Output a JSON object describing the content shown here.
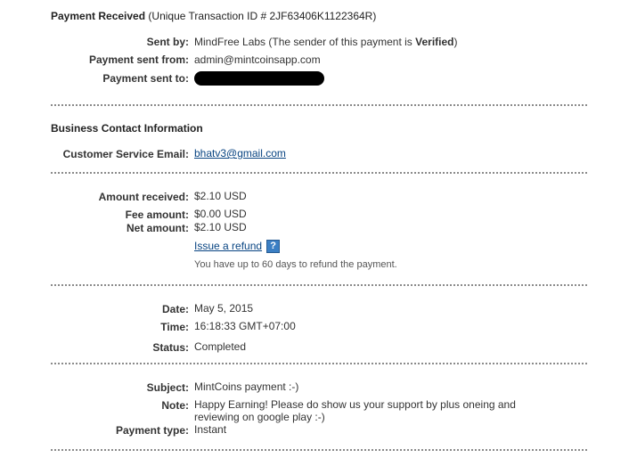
{
  "header": {
    "title": "Payment Received",
    "transaction": "(Unique Transaction ID # 2JF63406K1122364R)"
  },
  "sender": {
    "sent_by_label": "Sent by:",
    "sent_by_value": "MindFree Labs",
    "sent_by_note_prefix": "(The sender of this payment is ",
    "sent_by_note_status": "Verified",
    "sent_by_note_suffix": ")",
    "sent_from_label": "Payment sent from:",
    "sent_from_value": "admin@mintcoinsapp.com",
    "sent_to_label": "Payment sent to:"
  },
  "business": {
    "title": "Business Contact Information",
    "email_label": "Customer Service Email:",
    "email_value": "bhatv3@gmail.com"
  },
  "amounts": {
    "received_label": "Amount received:",
    "received_value": "$2.10 USD",
    "fee_label": "Fee amount:",
    "fee_value": "$0.00 USD",
    "net_label": "Net amount:",
    "net_value": "$2.10 USD",
    "refund_link": "Issue a refund",
    "help_icon": "?",
    "refund_note": "You have up to 60 days to refund the payment."
  },
  "datetime": {
    "date_label": "Date:",
    "date_value": "May 5, 2015",
    "time_label": "Time:",
    "time_value": "16:18:33 GMT+07:00",
    "status_label": "Status:",
    "status_value": "Completed"
  },
  "details": {
    "subject_label": "Subject:",
    "subject_value": "MintCoins payment :-)",
    "note_label": "Note:",
    "note_line1": "Happy Earning! Please do show us your support by plus oneing and",
    "note_line2": "reviewing on google play :-)",
    "type_label": "Payment type:",
    "type_value": "Instant"
  }
}
